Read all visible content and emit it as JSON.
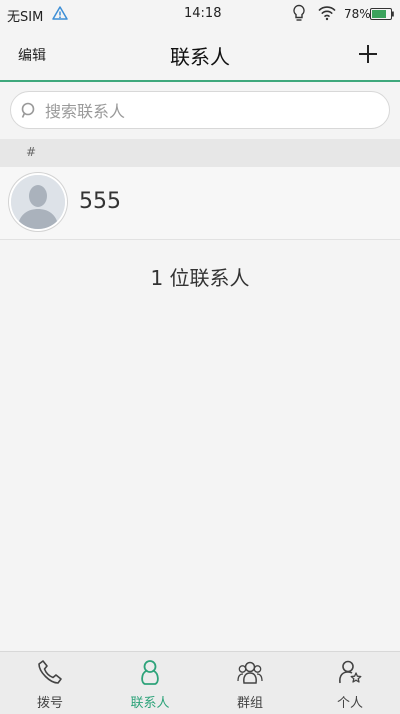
{
  "status_bar": {
    "carrier": "无SIM",
    "time": "14:18",
    "battery_percent": "78%",
    "battery_level": 0.78,
    "icons": [
      "warning-icon",
      "bulb-icon",
      "wifi-icon",
      "battery-icon"
    ]
  },
  "header": {
    "edit_label": "编辑",
    "title": "联系人",
    "add_icon": "plus-icon",
    "accent_color": "#3ea87c"
  },
  "search": {
    "placeholder": "搜索联系人",
    "value": ""
  },
  "section": {
    "label": "#"
  },
  "contacts": [
    {
      "name": "555",
      "avatar_icon": "default-avatar-icon"
    }
  ],
  "summary": "1 位联系人",
  "tabs": [
    {
      "label": "拨号",
      "icon": "phone-icon",
      "active": false
    },
    {
      "label": "联系人",
      "icon": "contacts-icon",
      "active": true
    },
    {
      "label": "群组",
      "icon": "group-icon",
      "active": false
    },
    {
      "label": "个人",
      "icon": "person-star-icon",
      "active": false
    }
  ]
}
